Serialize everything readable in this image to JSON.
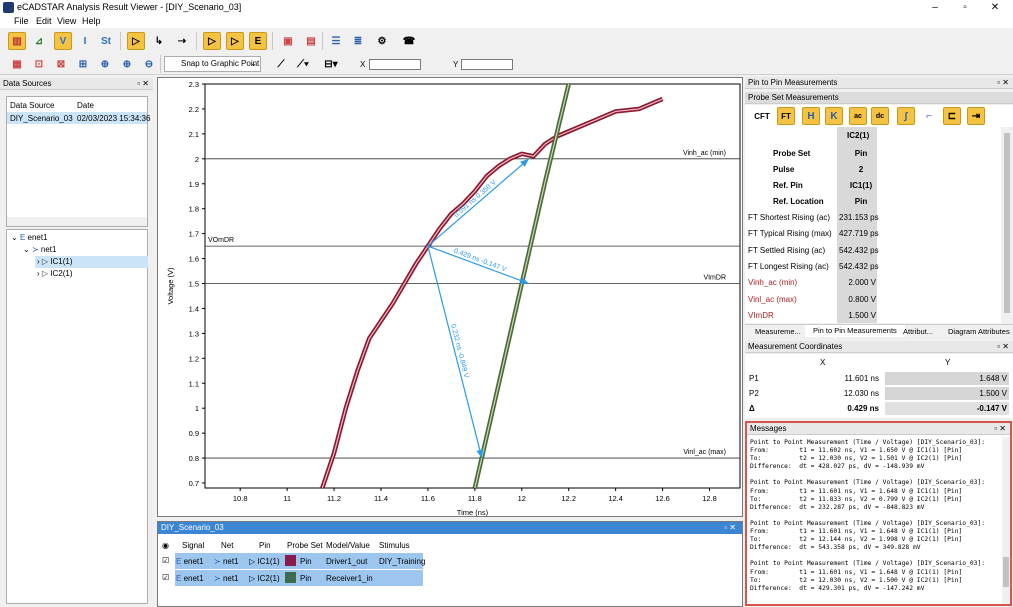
{
  "window": {
    "title": "eCADSTAR Analysis Result Viewer - [DIY_Scenario_03]",
    "min": "–",
    "max": "▫",
    "close": "✕"
  },
  "menu": [
    "File",
    "Edit",
    "View",
    "Help"
  ],
  "toolbar2": {
    "snap": "Snap to Graphic Point",
    "x_label": "X",
    "y_label": "Y"
  },
  "data_sources": {
    "title": "Data Sources",
    "headers": [
      "Data Source",
      "Date"
    ],
    "rows": [
      [
        "DIY_Scenario_03",
        "02/03/2023 15:34:36"
      ]
    ]
  },
  "tree": {
    "items": [
      "enet1",
      "net1",
      "IC1(1)",
      "IC2(1)"
    ]
  },
  "plot": {
    "ylabel": "Voltage (V)",
    "xlabel": "Time (ns)",
    "yticks": [
      "2.3",
      "2.2",
      "2.1",
      "2",
      "1.9",
      "1.8",
      "1.7",
      "1.6",
      "1.5",
      "1.4",
      "1.3",
      "1.2",
      "1.1",
      "1",
      "0.9",
      "0.8",
      "0.7"
    ],
    "xticks": [
      "10.8",
      "11",
      "11.2",
      "11.4",
      "11.6",
      "11.8",
      "12",
      "12.2",
      "12.4",
      "12.6",
      "12.8"
    ],
    "hlines": [
      "Vinh_ac (min)",
      "VOmDR",
      "VImDR",
      "Vinl_ac (max)"
    ],
    "annotations": [
      "0.591 ns  0.350 V",
      "0.429 ns  -0.147 V",
      "0.232 ns  -0.849 V"
    ]
  },
  "chart_data": {
    "type": "line",
    "xlabel": "Time (ns)",
    "ylabel": "Voltage (V)",
    "xlim": [
      10.65,
      12.93
    ],
    "ylim": [
      0.68,
      2.3
    ],
    "reference_lines": [
      {
        "name": "Vinh_ac (min)",
        "y": 2.0
      },
      {
        "name": "VOmDR",
        "y": 1.65
      },
      {
        "name": "VImDR",
        "y": 1.5
      },
      {
        "name": "Vinl_ac (max)",
        "y": 0.8
      }
    ],
    "series": [
      {
        "name": "Driver1_out",
        "color": "#8b1a2e",
        "x": [
          11.15,
          11.2,
          11.25,
          11.3,
          11.35,
          11.4,
          11.45,
          11.5,
          11.55,
          11.6,
          11.65,
          11.7,
          11.75,
          11.8,
          11.85,
          11.9,
          11.95,
          12.0,
          12.05,
          12.1,
          12.15,
          12.2,
          12.3,
          12.4,
          12.5,
          12.6
        ],
        "y": [
          0.68,
          0.82,
          1.0,
          1.15,
          1.28,
          1.35,
          1.42,
          1.5,
          1.58,
          1.65,
          1.72,
          1.78,
          1.82,
          1.87,
          1.93,
          1.97,
          2.0,
          2.02,
          2.01,
          2.06,
          2.09,
          2.11,
          2.15,
          2.19,
          2.2,
          2.24
        ]
      },
      {
        "name": "Receiver1_in",
        "color": "#4a6b3a",
        "x": [
          11.8,
          11.9,
          12.0,
          12.1,
          12.2,
          12.25
        ],
        "y": [
          0.68,
          1.09,
          1.5,
          1.91,
          2.3,
          2.5
        ]
      }
    ],
    "arrows": [
      {
        "from": [
          11.6,
          1.65
        ],
        "to": [
          12.03,
          2.0
        ],
        "label": "0.591 ns  0.350 V"
      },
      {
        "from": [
          11.6,
          1.65
        ],
        "to": [
          12.03,
          1.5
        ],
        "label": "0.429 ns  -0.147 V"
      },
      {
        "from": [
          11.6,
          1.65
        ],
        "to": [
          11.83,
          0.8
        ],
        "label": "0.232 ns  -0.849 V"
      }
    ]
  },
  "signals": {
    "title": "DIY_Scenario_03",
    "headers": [
      "Signal",
      "Net",
      "Pin",
      "Probe Set",
      "Model/Value",
      "Stimulus"
    ],
    "rows": [
      [
        "enet1",
        "net1",
        "IC1(1)",
        "Pin",
        "Driver1_out",
        "DIY_Training"
      ],
      [
        "enet1",
        "net1",
        "IC2(1)",
        "Pin",
        "Receiver1_in",
        ""
      ]
    ],
    "colors": [
      "#8b1a2e",
      "#3e6b4f"
    ]
  },
  "ptp": {
    "title": "Pin to Pin Measurements",
    "sub": "Probe Set Measurements",
    "col": "IC2(1)",
    "rows": [
      [
        "Probe Set",
        "Pin"
      ],
      [
        "Pulse",
        "2"
      ],
      [
        "Ref. Pin",
        "IC1(1)"
      ],
      [
        "Ref. Location",
        "Pin"
      ],
      [
        "FT Shortest Rising (ac)",
        "231.153 ps"
      ],
      [
        "FT Typical Rising (max)",
        "427.719 ps"
      ],
      [
        "FT Settled Rising (ac)",
        "542.432 ps"
      ],
      [
        "FT Longest Rising (ac)",
        "542.432 ps"
      ],
      [
        "Vinh_ac (min)",
        "2.000 V"
      ],
      [
        "Vinl_ac (max)",
        "0.800 V"
      ],
      [
        "VImDR",
        "1.500 V"
      ]
    ],
    "tabs": [
      "Measureme...",
      "Pin to Pin Measurements",
      "Attribut...",
      "Diagram Attributes"
    ]
  },
  "coords": {
    "title": "Measurement Coordinates",
    "headers": [
      "X",
      "Y"
    ],
    "rows": [
      [
        "P1",
        "11.601 ns",
        "1.648 V"
      ],
      [
        "P2",
        "12.030 ns",
        "1.500 V"
      ],
      [
        "Δ",
        "0.429 ns",
        "-0.147 V"
      ]
    ]
  },
  "messages": {
    "title": "Messages",
    "text": "Point to Point Measurement (Time / Voltage) [DIY_Scenario_03]:\nFrom:        t1 = 11.602 ns, V1 = 1.650 V @ IC1(1) [Pin]\nTo:          t2 = 12.030 ns, V2 = 1.501 V @ IC2(1) [Pin]\nDifference:  dt = 428.027 ps, dV = -148.939 mV\n\nPoint to Point Measurement (Time / Voltage) [DIY_Scenario_03]:\nFrom:        t1 = 11.601 ns, V1 = 1.648 V @ IC1(1) [Pin]\nTo:          t2 = 11.833 ns, V2 = 0.799 V @ IC2(1) [Pin]\nDifference:  dt = 232.287 ps, dV = -848.823 mV\n\nPoint to Point Measurement (Time / Voltage) [DIY_Scenario_03]:\nFrom:        t1 = 11.601 ns, V1 = 1.648 V @ IC1(1) [Pin]\nTo:          t2 = 12.144 ns, V2 = 1.998 V @ IC2(1) [Pin]\nDifference:  dt = 543.358 ps, dV = 349.828 mV\n\nPoint to Point Measurement (Time / Voltage) [DIY_Scenario_03]:\nFrom:        t1 = 11.601 ns, V1 = 1.648 V @ IC1(1) [Pin]\nTo:          t2 = 12.030 ns, V2 = 1.500 V @ IC2(1) [Pin]\nDifference:  dt = 429.301 ps, dV = -147.242 mV"
  }
}
